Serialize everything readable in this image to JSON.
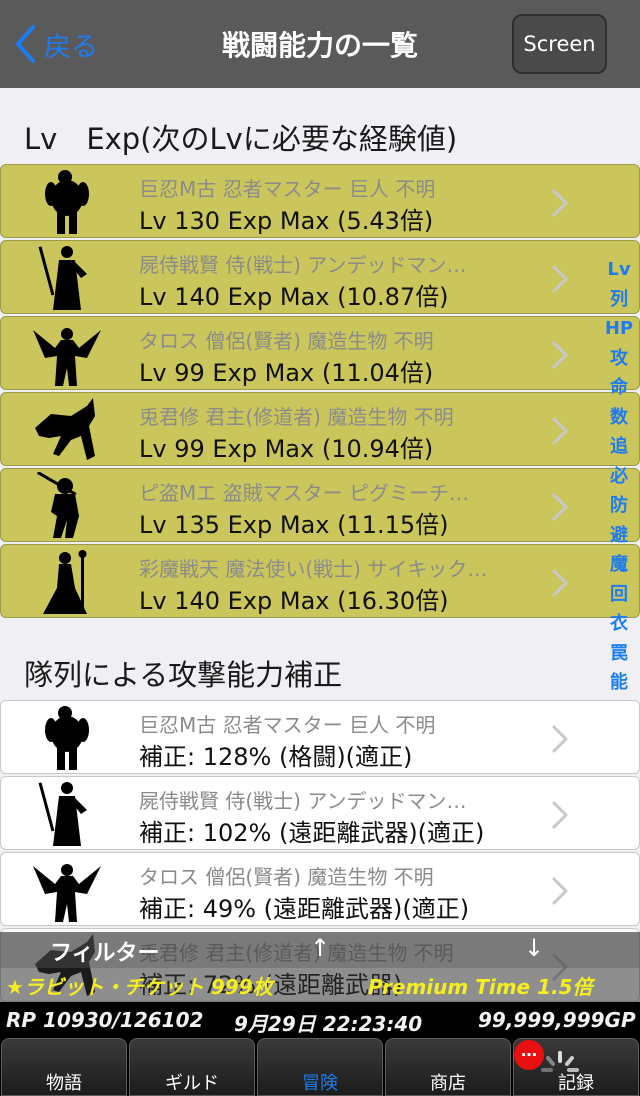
{
  "navbar": {
    "back_label": "戻る",
    "title": "戦闘能力の一覧",
    "screen_label": "Screen"
  },
  "section_exp": {
    "header": "Lv　Exp(次のLvに必要な経験値)",
    "rows": [
      {
        "sub": "巨忍M古 忍者マスター 巨人 不明",
        "main": "Lv 130  Exp Max (5.43倍)"
      },
      {
        "sub": "屍侍戦賢 侍(戦士) アンデッドマン…",
        "main": "Lv 140  Exp Max (10.87倍)"
      },
      {
        "sub": "タロス 僧侶(賢者) 魔造生物 不明",
        "main": "Lv 99  Exp Max (11.04倍)"
      },
      {
        "sub": "兎君修 君主(修道者) 魔造生物 不明",
        "main": "Lv 99  Exp Max (10.94倍)"
      },
      {
        "sub": "ピ盗Mエ 盗賊マスター ピグミーチ…",
        "main": "Lv 135  Exp Max (11.15倍)"
      },
      {
        "sub": "彩魔戦天 魔法使い(戦士) サイキック…",
        "main": "Lv 140  Exp Max (16.30倍)"
      }
    ]
  },
  "section_attack": {
    "header": "隊列による攻撃能力補正",
    "rows": [
      {
        "sub": "巨忍M古 忍者マスター 巨人 不明",
        "main": "補正: 128%  (格闘)(適正)"
      },
      {
        "sub": "屍侍戦賢 侍(戦士) アンデッドマン…",
        "main": "補正: 102%  (遠距離武器)(適正)"
      },
      {
        "sub": "タロス 僧侶(賢者) 魔造生物 不明",
        "main": "補正: 49%  (遠距離武器)(適正)"
      },
      {
        "sub": "兎君修 君主(修道者) 魔造生物 不明",
        "main": "補正: 72%  (遠距離武器)"
      }
    ]
  },
  "side_index": [
    "Lv",
    "列",
    "HP",
    "攻",
    "命",
    "数",
    "追",
    "必",
    "防",
    "避",
    "魔",
    "回",
    "衣",
    "罠",
    "能"
  ],
  "filter": {
    "label": "フィルター",
    "up": "↑",
    "down": "↓"
  },
  "ticket": {
    "label": "★ラビット・チケット 999枚",
    "premium": "Premium Time 1.5倍"
  },
  "status": {
    "rp": "RP 10930/126102",
    "datetime": "9月29日 22:23:40",
    "gold": "99,999,999GP"
  },
  "tabs": [
    {
      "label": "物語",
      "active": false
    },
    {
      "label": "ギルド",
      "active": false
    },
    {
      "label": "冒険",
      "active": true
    },
    {
      "label": "商店",
      "active": false
    },
    {
      "label": "記録",
      "active": false
    }
  ],
  "badge": "…",
  "colors": {
    "accent": "#1e7cf0",
    "row_highlight": "#cbc65c",
    "ticket_yellow": "#f4ee20",
    "navbar": "#5a5a5a"
  }
}
